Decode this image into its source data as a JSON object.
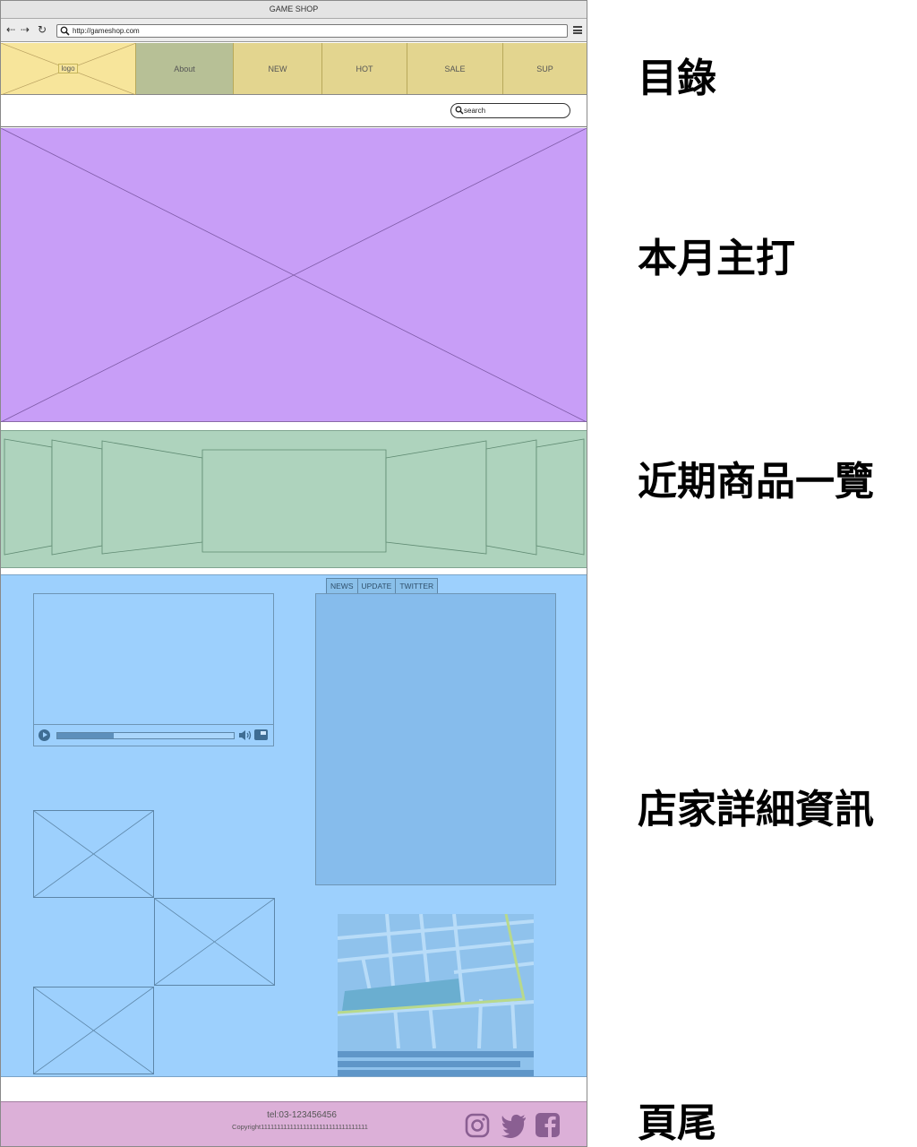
{
  "browser": {
    "window_title": "GAME SHOP",
    "url": "http://gameshop.com"
  },
  "nav": {
    "logo": "logo",
    "items": [
      "About",
      "NEW",
      "HOT",
      "SALE",
      "SUP"
    ]
  },
  "search": {
    "placeholder": "search"
  },
  "store": {
    "tabs": [
      "NEWS",
      "UPDATE",
      "TWITTER"
    ],
    "video_progress": 0.32
  },
  "footer": {
    "tel": "tel:03-123456456",
    "copyright": "Copyright111111111111111111111111111111111"
  },
  "section_labels": {
    "menu": "目錄",
    "hero": "本月主打",
    "recent": "近期商品一覽",
    "store": "店家詳細資訊",
    "footer": "頁尾"
  },
  "icons": [
    "search-icon",
    "back-arrow-icon",
    "forward-arrow-icon",
    "refresh-icon",
    "hamburger-menu-icon",
    "play-icon",
    "volume-icon",
    "fullscreen-icon",
    "instagram-icon",
    "twitter-icon",
    "facebook-icon"
  ],
  "colors": {
    "nav": "#e3d58f",
    "nav_logo": "#f7e59b",
    "nav_about": "#b7c096",
    "hero": "#c89ef7",
    "carousel": "#aed3bd",
    "store": "#9dd0fd",
    "footer": "#dcb0d8"
  }
}
